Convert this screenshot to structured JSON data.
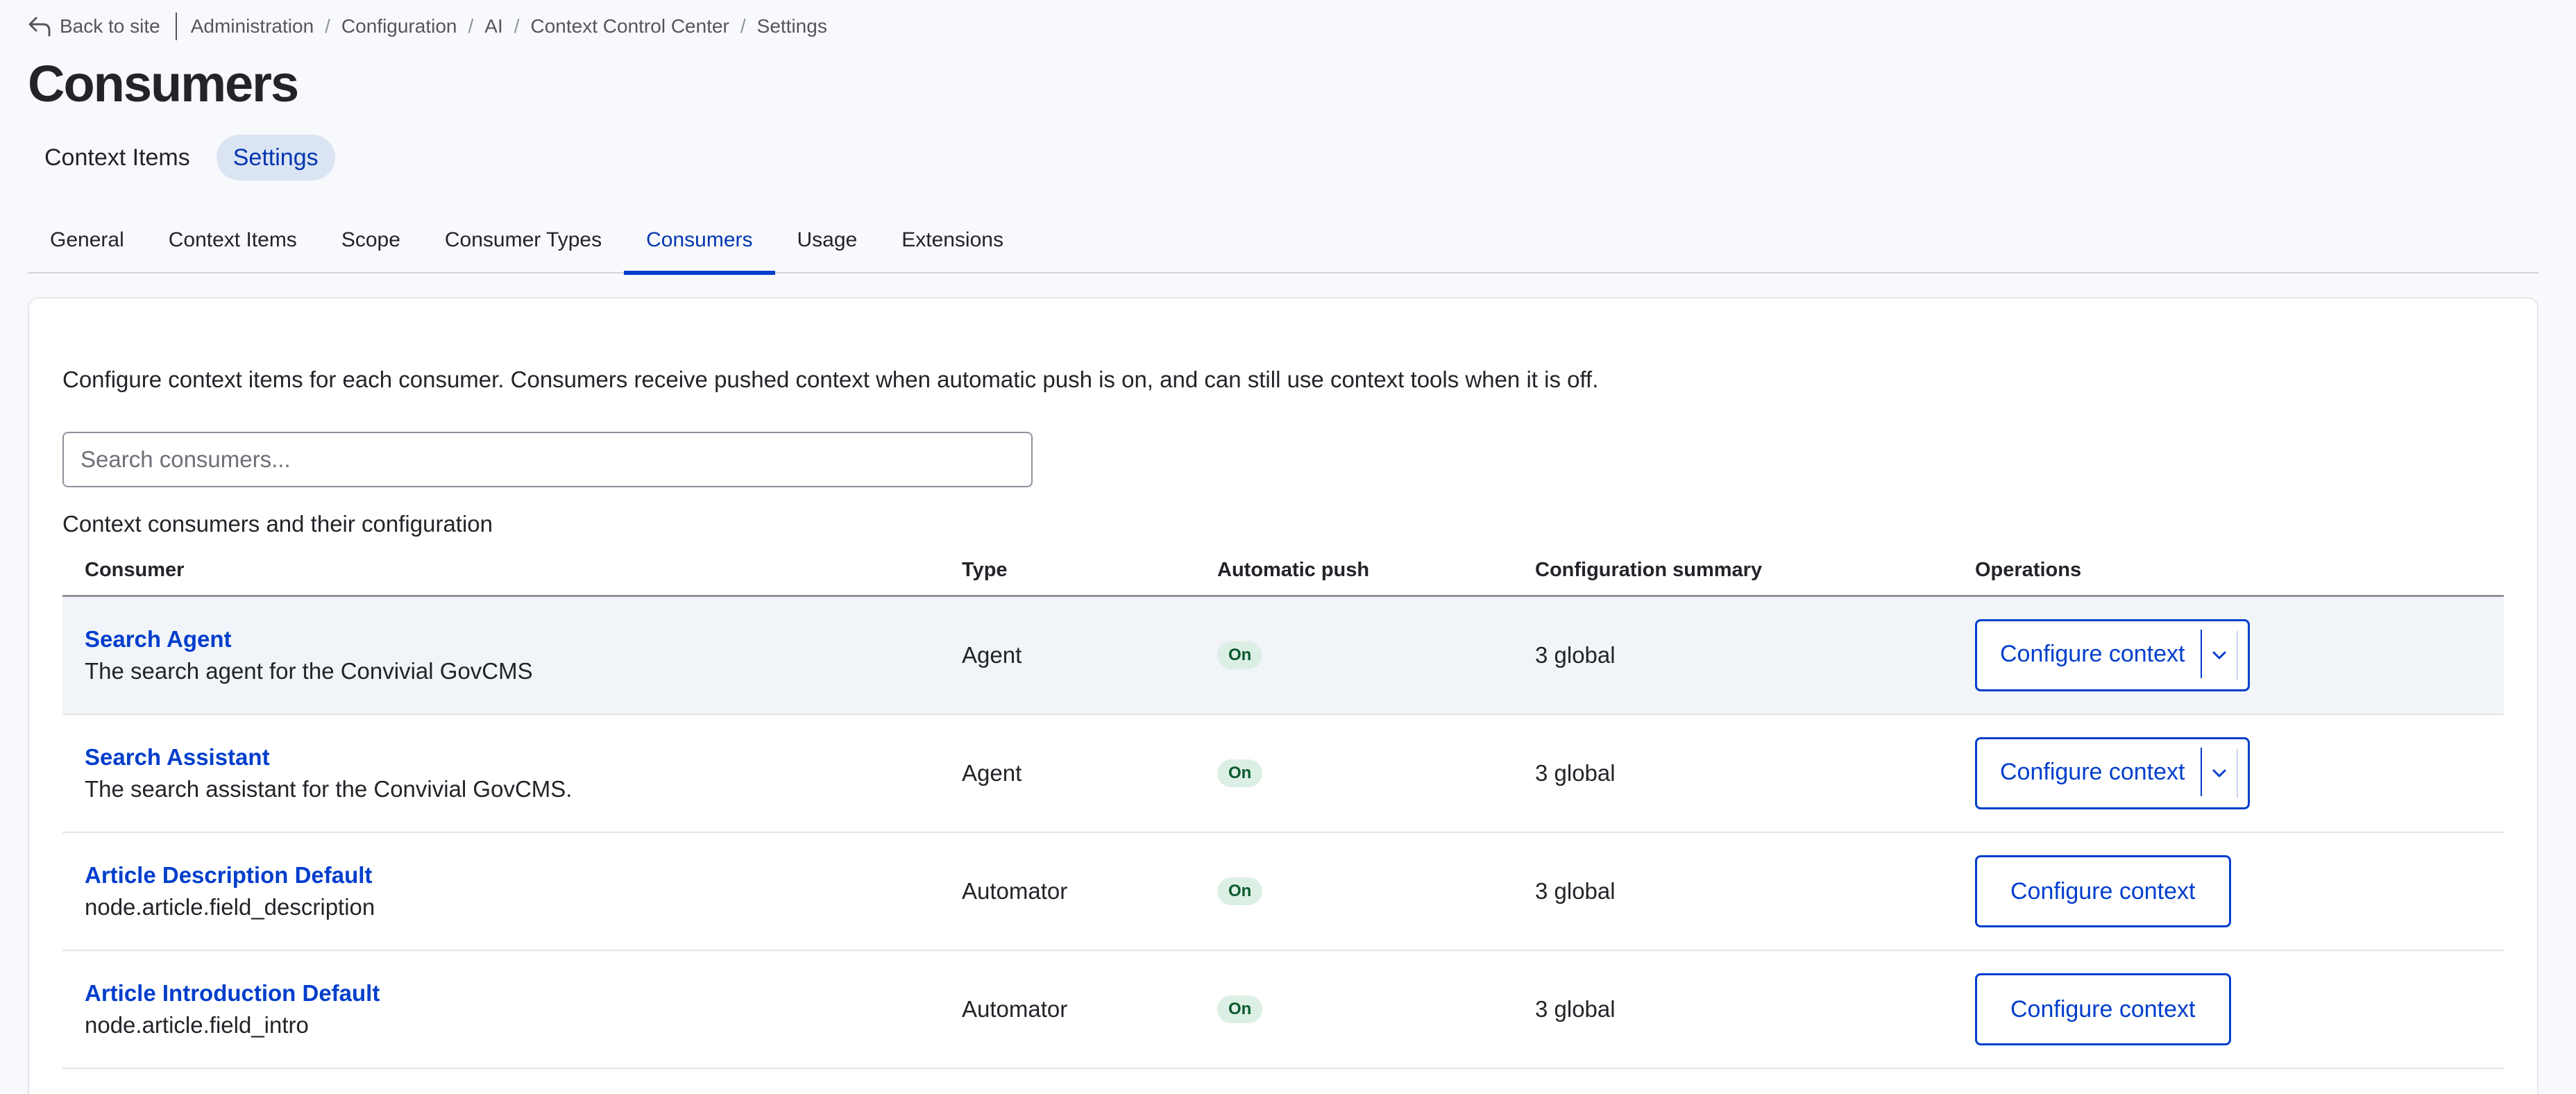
{
  "topbar": {
    "back_label": "Back to site",
    "breadcrumbs": [
      "Administration",
      "Configuration",
      "AI",
      "Context Control Center",
      "Settings"
    ]
  },
  "page": {
    "title": "Consumers"
  },
  "primary_tabs": [
    {
      "label": "Context Items",
      "active": false
    },
    {
      "label": "Settings",
      "active": true
    }
  ],
  "secondary_tabs": [
    {
      "label": "General",
      "active": false
    },
    {
      "label": "Context Items",
      "active": false
    },
    {
      "label": "Scope",
      "active": false
    },
    {
      "label": "Consumer Types",
      "active": false
    },
    {
      "label": "Consumers",
      "active": true
    },
    {
      "label": "Usage",
      "active": false
    },
    {
      "label": "Extensions",
      "active": false
    }
  ],
  "main": {
    "intro": "Configure context items for each consumer. Consumers receive pushed context when automatic push is on, and can still use context tools when it is off.",
    "search": {
      "placeholder": "Search consumers...",
      "value": ""
    },
    "table_caption": "Context consumers and their configuration",
    "columns": [
      "Consumer",
      "Type",
      "Automatic push",
      "Configuration summary",
      "Operations"
    ],
    "rows": [
      {
        "name": "Search Agent",
        "description": "The search agent for the Convivial GovCMS",
        "type": "Agent",
        "push": "On",
        "summary": "3 global",
        "operation": "Configure context",
        "has_dropdown": true
      },
      {
        "name": "Search Assistant",
        "description": "The search assistant for the Convivial GovCMS.",
        "type": "Agent",
        "push": "On",
        "summary": "3 global",
        "operation": "Configure context",
        "has_dropdown": true
      },
      {
        "name": "Article Description Default",
        "description": "node.article.field_description",
        "type": "Automator",
        "push": "On",
        "summary": "3 global",
        "operation": "Configure context",
        "has_dropdown": false
      },
      {
        "name": "Article Introduction Default",
        "description": "node.article.field_intro",
        "type": "Automator",
        "push": "On",
        "summary": "3 global",
        "operation": "Configure context",
        "has_dropdown": false
      }
    ]
  },
  "colors": {
    "accent": "#003ecc",
    "badge_bg": "#dcefe4",
    "badge_text": "#0b5a2e"
  }
}
